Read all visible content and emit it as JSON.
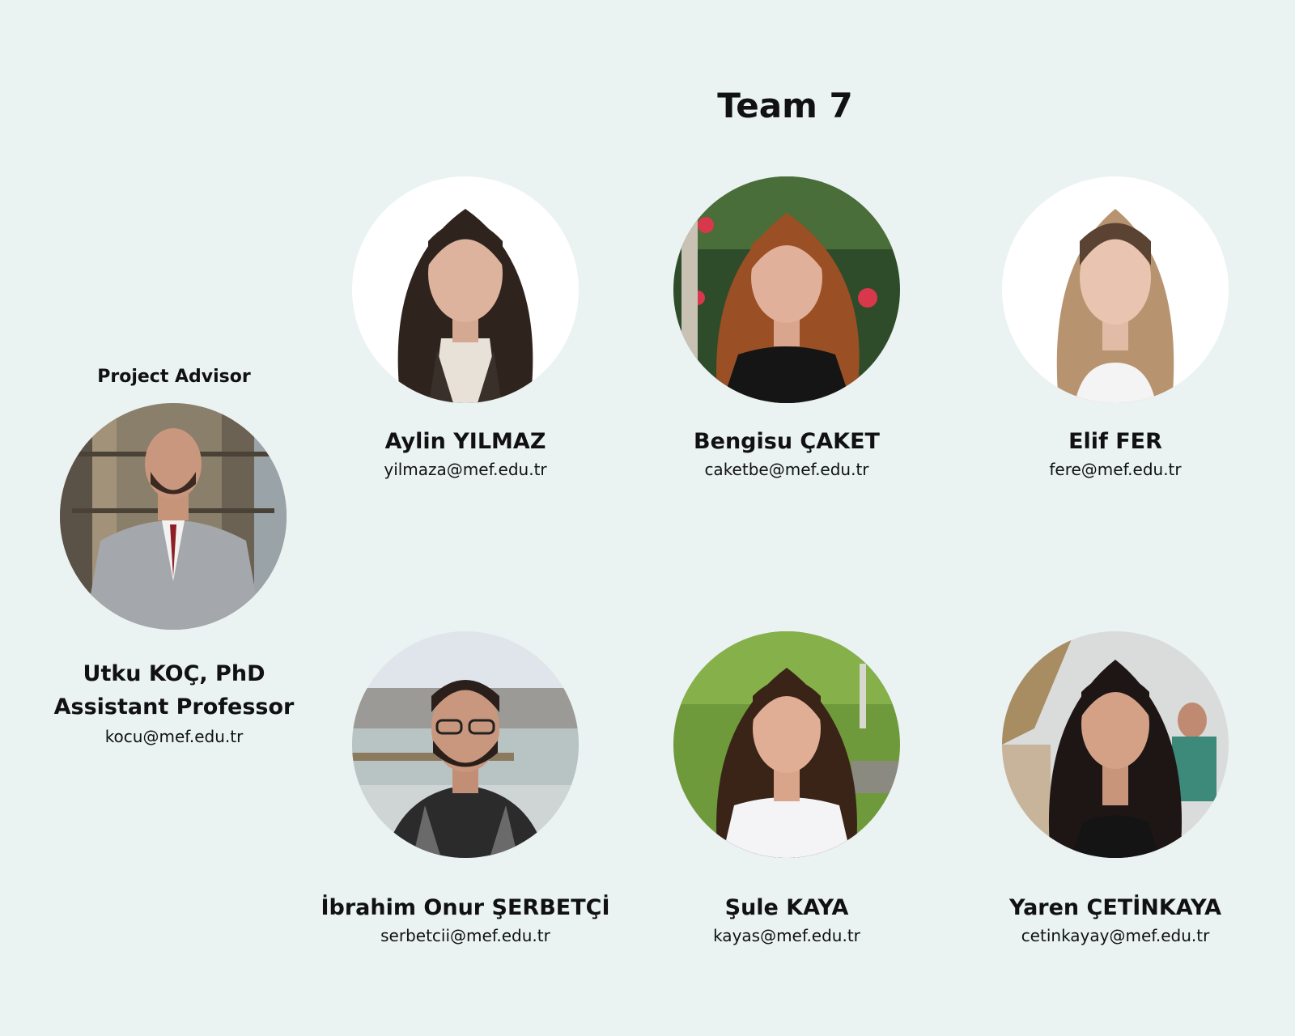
{
  "title": "Team 7",
  "advisor": {
    "caption": "Project Advisor",
    "name": "Utku KOÇ, PhD",
    "role": "Assistant Professor",
    "email": "kocu@mef.edu.tr"
  },
  "members": [
    {
      "name": "Aylin YILMAZ",
      "email": "yilmaza@mef.edu.tr"
    },
    {
      "name": "Bengisu ÇAKET",
      "email": "caketbe@mef.edu.tr"
    },
    {
      "name": "Elif FER",
      "email": "fere@mef.edu.tr"
    },
    {
      "name": "İbrahim Onur ŞERBETÇİ",
      "email": "serbetcii@mef.edu.tr"
    },
    {
      "name": "Şule KAYA",
      "email": "kayas@mef.edu.tr"
    },
    {
      "name": "Yaren ÇETİNKAYA",
      "email": "cetinkayay@mef.edu.tr"
    }
  ],
  "colors": {
    "background": "#eaf2f2",
    "text": "#111111"
  }
}
